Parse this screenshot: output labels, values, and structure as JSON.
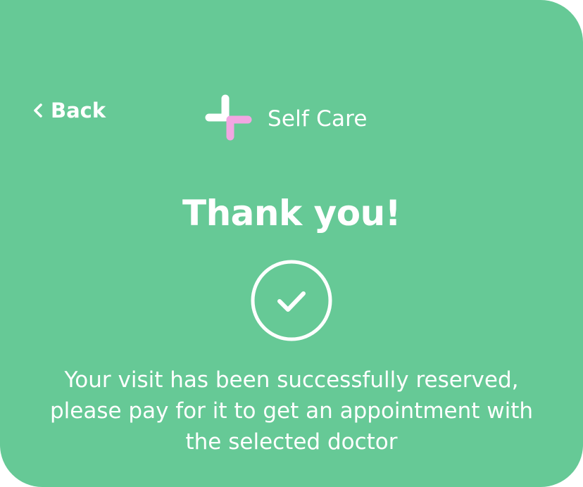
{
  "nav": {
    "back_label": "Back"
  },
  "brand": {
    "name": "Self Care",
    "logo_colors": [
      "#ffffff",
      "#f2a6e2"
    ]
  },
  "content": {
    "title": "Thank you!",
    "message": "Your visit has been successfully reserved, please pay for it to get an appointment with the selected doctor",
    "status_icon": "check-circle-icon"
  },
  "theme": {
    "background": "#66c996",
    "text": "#ffffff",
    "accent_pink": "#f2a6e2"
  }
}
